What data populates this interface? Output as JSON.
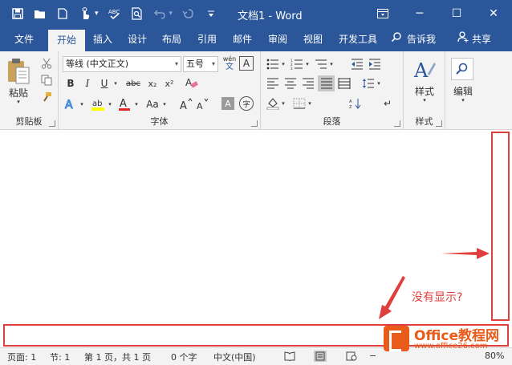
{
  "window": {
    "title": "文档1 - Word",
    "ribbon_display_icon": "ribbon-display-icon",
    "minimize": "─",
    "maximize": "☐",
    "close": "✕"
  },
  "qat": {
    "save": "💾",
    "open": "📂",
    "new": "🗋",
    "touch": "☝",
    "spelling": "ABC",
    "preview": "🔍",
    "undo": "↶",
    "redo": "↷",
    "customize": "≡"
  },
  "tabs": [
    "文件",
    "开始",
    "插入",
    "设计",
    "布局",
    "引用",
    "邮件",
    "审阅",
    "视图",
    "开发工具"
  ],
  "active_tab": "开始",
  "tell_me": "告诉我",
  "share": "共享",
  "ribbon": {
    "clipboard": {
      "label": "剪贴板",
      "paste": "粘贴",
      "cut": "✂",
      "copy": "⧉",
      "format_painter": "🖌"
    },
    "font": {
      "label": "字体",
      "font_name": "等线 (中文正文)",
      "font_size": "五号",
      "phonetic_top": "wén",
      "phonetic_bottom": "文",
      "char_border": "A",
      "bold": "B",
      "italic": "I",
      "underline": "U",
      "strike": "abc",
      "subscript": "x₂",
      "superscript": "x²",
      "clear": "A",
      "text_effects": "A",
      "highlight": "ab",
      "font_color": "A",
      "case": "Aa",
      "grow": "A",
      "shrink": "A",
      "shading": "A",
      "enclose": "字"
    },
    "paragraph": {
      "label": "段落"
    },
    "styles": {
      "label": "样式",
      "button": "样式"
    },
    "editing": {
      "label": "编辑"
    }
  },
  "statusbar": {
    "page": "页面: 1",
    "section": "节: 1",
    "pages": "第 1 页，共 1 页",
    "words": "0 个字",
    "language": "中文(中国)",
    "zoom": "80%"
  },
  "annotation": {
    "text": "没有显示?",
    "color": "#e0403d"
  },
  "watermark": {
    "brand": "Office教程网",
    "url": "www.office26.com"
  },
  "colors": {
    "accent": "#2b579a",
    "ribbon_bg": "#f3f3f3",
    "highlight": "#2b579a"
  }
}
